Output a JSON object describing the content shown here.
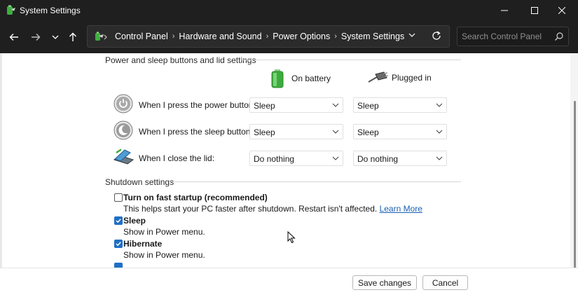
{
  "window": {
    "title": "System Settings",
    "controls": {
      "minimize": "—",
      "maximize": "☐",
      "close": "✕"
    }
  },
  "nav": {
    "back_icon": "arrow-left-icon",
    "forward_icon": "arrow-right-icon",
    "recent_icon": "chevron-down-icon",
    "up_icon": "arrow-up-icon",
    "breadcrumb": [
      "Control Panel",
      "Hardware and Sound",
      "Power Options",
      "System Settings"
    ],
    "search_placeholder": "Search Control Panel"
  },
  "power_section": {
    "title": "Power and sleep buttons and lid settings",
    "columns": {
      "battery": "On battery",
      "plugged": "Plugged in"
    },
    "rows": [
      {
        "label": "When I press the power button:",
        "battery": "Sleep",
        "plugged": "Sleep",
        "icon": "power-button-icon"
      },
      {
        "label": "When I press the sleep button:",
        "battery": "Sleep",
        "plugged": "Sleep",
        "icon": "sleep-button-icon"
      },
      {
        "label": "When I close the lid:",
        "battery": "Do nothing",
        "plugged": "Do nothing",
        "icon": "laptop-lid-icon"
      }
    ]
  },
  "shutdown_section": {
    "title": "Shutdown settings",
    "options": [
      {
        "label": "Turn on fast startup (recommended)",
        "desc": "This helps start your PC faster after shutdown. Restart isn't affected.",
        "link": "Learn More",
        "checked": false
      },
      {
        "label": "Sleep",
        "desc": "Show in Power menu.",
        "checked": true
      },
      {
        "label": "Hibernate",
        "desc": "Show in Power menu.",
        "checked": true
      }
    ]
  },
  "footer": {
    "save": "Save changes",
    "cancel": "Cancel"
  },
  "colors": {
    "titlebar": "#1f1f1f",
    "accent": "#1f6fc5",
    "link": "#1a5fb4"
  }
}
